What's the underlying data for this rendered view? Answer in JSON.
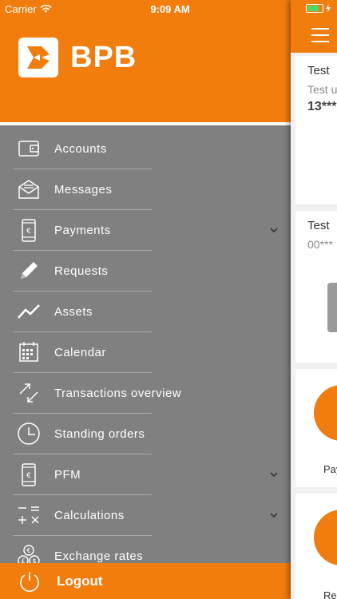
{
  "status_bar": {
    "carrier": "Carrier",
    "time": "9:09 AM"
  },
  "brand": {
    "name": "BPB",
    "accent": "#f07d0e",
    "drawer_bg": "#808080"
  },
  "menu": [
    {
      "label": "Accounts",
      "icon": "wallet-icon",
      "has_chevron": false
    },
    {
      "label": "Messages",
      "icon": "envelope-icon",
      "has_chevron": false
    },
    {
      "label": "Payments",
      "icon": "phone-euro-icon",
      "has_chevron": true
    },
    {
      "label": "Requests",
      "icon": "pencil-icon",
      "has_chevron": false
    },
    {
      "label": "Assets",
      "icon": "trend-line-icon",
      "has_chevron": false
    },
    {
      "label": "Calendar",
      "icon": "calendar-icon",
      "has_chevron": false
    },
    {
      "label": "Transactions overview",
      "icon": "arrows-icon",
      "has_chevron": false
    },
    {
      "label": "Standing orders",
      "icon": "clock-icon",
      "has_chevron": false
    },
    {
      "label": "PFM",
      "icon": "phone-euro-icon",
      "has_chevron": true
    },
    {
      "label": "Calculations",
      "icon": "calculator-icon",
      "has_chevron": true
    },
    {
      "label": "Exchange rates",
      "icon": "currency-icon",
      "has_chevron": false
    }
  ],
  "logout": {
    "label": "Logout",
    "icon": "power-icon"
  },
  "content": {
    "card1": {
      "title": "Test",
      "subtitle": "Test u",
      "number": "13***"
    },
    "card2": {
      "title": "Test",
      "number": "00***"
    },
    "card3": {
      "label": "Pay"
    },
    "card4": {
      "label": "Re"
    }
  }
}
